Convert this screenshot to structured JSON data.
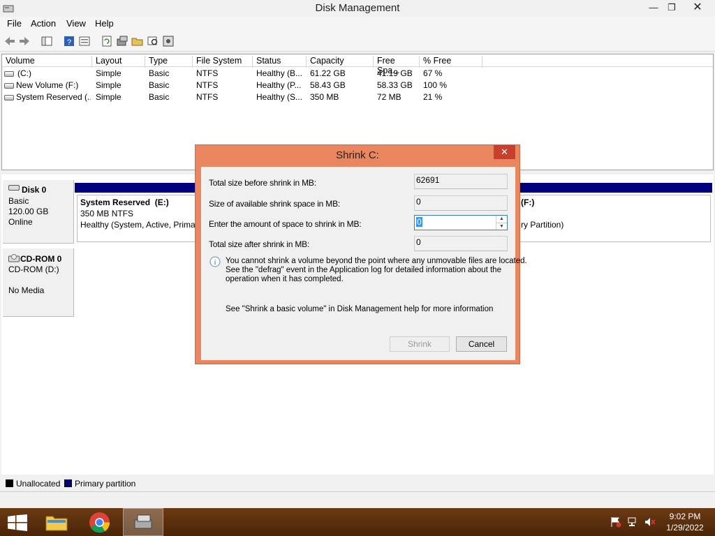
{
  "window": {
    "title": "Disk Management"
  },
  "menu": [
    "File",
    "Action",
    "View",
    "Help"
  ],
  "columns": [
    "Volume",
    "Layout",
    "Type",
    "File System",
    "Status",
    "Capacity",
    "Free Spa...",
    "% Free"
  ],
  "volumes": [
    [
      "(C:)",
      "Simple",
      "Basic",
      "NTFS",
      "Healthy (B...",
      "61.22 GB",
      "41.19 GB",
      "67 %"
    ],
    [
      "New Volume (F:)",
      "Simple",
      "Basic",
      "NTFS",
      "Healthy (P...",
      "58.43 GB",
      "58.33 GB",
      "100 %"
    ],
    [
      "System Reserved (...",
      "Simple",
      "Basic",
      "NTFS",
      "Healthy (S...",
      "350 MB",
      "72 MB",
      "21 %"
    ]
  ],
  "disk0": {
    "name": "Disk 0",
    "type": "Basic",
    "size": "120.00 GB",
    "state": "Online",
    "partitions": [
      {
        "name": "System Reserved  (E:)",
        "size": "350 MB NTFS",
        "status": "Healthy (System, Active, Primar"
      },
      {
        "name": "(F:)",
        "size": "",
        "status": "ry Partition)"
      }
    ]
  },
  "cdrom0": {
    "name": "CD-ROM 0",
    "drive": "CD-ROM (D:)",
    "media": "No Media"
  },
  "legend": [
    "Unallocated",
    "Primary partition"
  ],
  "colors": {
    "unallocated": "#000000",
    "primary": "#00007f",
    "dialog_frame": "#e9865f",
    "close": "#c7402e",
    "taskbar": "#5a2d0c"
  },
  "dialog": {
    "title": "Shrink C:",
    "fields": [
      {
        "label": "Total size before shrink in MB:",
        "value": "62691"
      },
      {
        "label": "Size of available shrink space in MB:",
        "value": "0"
      },
      {
        "label": "Enter the amount of space to shrink in MB:",
        "value": "0"
      },
      {
        "label": "Total size after shrink in MB:",
        "value": "0"
      }
    ],
    "info_lines": [
      "You cannot shrink a volume beyond the point where any unmovable files are located.",
      "See the \"defrag\" event in the Application log for detailed information about the",
      "operation when it has completed."
    ],
    "help_text": "See \"Shrink a basic volume\" in Disk Management help for more information",
    "shrink_label": "Shrink",
    "cancel_label": "Cancel"
  },
  "taskbar": {
    "time": "9:02 PM",
    "date": "1/29/2022"
  }
}
